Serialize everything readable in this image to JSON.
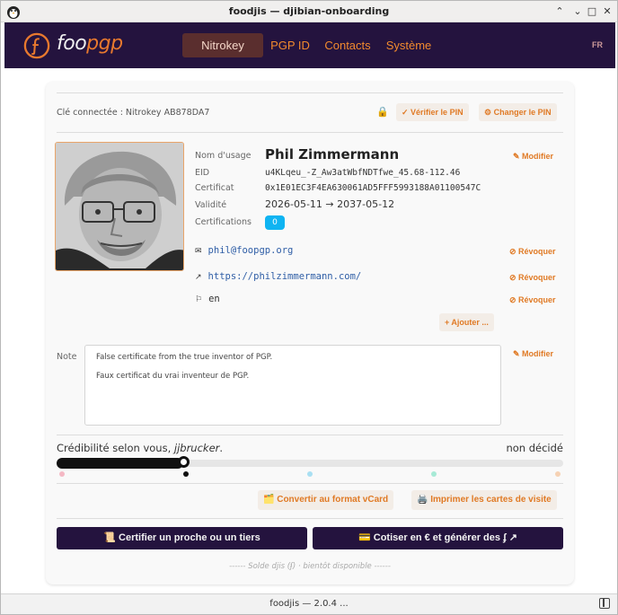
{
  "window": {
    "title": "foodjis — djibian-onboarding",
    "min_glyph": "⌃",
    "min2_glyph": "⌄",
    "max_glyph": "□",
    "close_glyph": "✕"
  },
  "nav": {
    "logo_text_a": "foo",
    "logo_text_b": "pgp",
    "tabs": [
      {
        "label": "Nitrokey",
        "active": true
      },
      {
        "label": "PGP ID",
        "active": false
      },
      {
        "label": "Contacts",
        "active": false
      },
      {
        "label": "Système",
        "active": false
      }
    ],
    "lang": "FR"
  },
  "key": {
    "connected_label": "Clé connectée : Nitrokey AB878DA7",
    "verify_pin": "✓ Vérifier le PIN",
    "change_pin": "⚙ Changer le PIN"
  },
  "identity": {
    "name_label": "Nom d'usage",
    "name": "Phil Zimmermann",
    "eid_label": "EID",
    "eid": "u4KLqeu_-Z_Aw3atWbfNDTfwe_45.68-112.46",
    "cert_label": "Certificat",
    "cert": "0x1E01EC3F4EA630061AD5FFF5993188A01100547C",
    "validity_label": "Validité",
    "validity": "2026-05-11 → 2037-05-12",
    "certifications_label": "Certifications",
    "certifications_count": "0",
    "modify": "✎ Modifier"
  },
  "uids": [
    {
      "sym": "✉",
      "value": "phil@foopgp.org",
      "action": "⊘ Révoquer"
    },
    {
      "sym": "↗",
      "value": "https://philzimmermann.com/",
      "action": "⊘ Révoquer"
    },
    {
      "sym": "⚐",
      "value": "en",
      "action": "⊘ Révoquer"
    }
  ],
  "add_label": "+ Ajouter ...",
  "note": {
    "label": "Note",
    "line1": "False certificate from the true inventor of PGP.",
    "line2": "Faux certificat du vrai inventeur de PGP.",
    "modify": "✎ Modifier"
  },
  "credibility": {
    "title_prefix": "Crédibilité selon vous, ",
    "user": "jjbrucker",
    "title_suffix": ".",
    "status": "non décidé",
    "level": 0.25,
    "levels": [
      {
        "pos": 0.0,
        "color": "#f4b8c4"
      },
      {
        "pos": 0.25,
        "color": "#111111"
      },
      {
        "pos": 0.5,
        "color": "#a9dff2"
      },
      {
        "pos": 0.75,
        "color": "#a7ead6"
      },
      {
        "pos": 1.0,
        "color": "#f6d2b4"
      }
    ]
  },
  "export": {
    "vcard": "🗂️ Convertir au format vCard",
    "print": "🖨️ Imprimer les cartes de visite"
  },
  "actions": {
    "certify": "📜 Certifier un proche ou un tiers",
    "cotiser": "💳 Cotiser en € et générer des ʄ ↗"
  },
  "footer_note": "------ Solde djis (ʄ) · bientôt disponible ------",
  "status_bar": "foodjis — 2.0.4 ...",
  "colors": {
    "nav_bg": "#24133e",
    "accent": "#e07a25",
    "link": "#2f5ea6",
    "badge": "#0fb4f2"
  }
}
